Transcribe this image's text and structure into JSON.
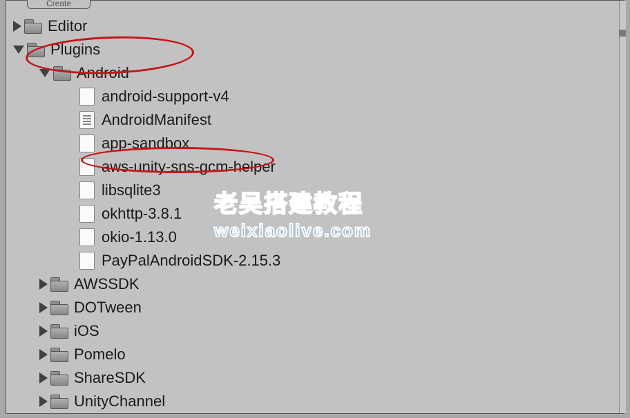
{
  "tab_label": "Create",
  "watermark": {
    "line1": "老吴搭建教程",
    "line2": "weixiaolive.com"
  },
  "tree": {
    "editor": {
      "label": "Editor",
      "type": "folder",
      "expanded": false,
      "depth": 0
    },
    "plugins": {
      "label": "Plugins",
      "type": "folder",
      "expanded": true,
      "depth": 0,
      "circled": true
    },
    "android": {
      "label": "Android",
      "type": "folder",
      "expanded": true,
      "depth": 1
    },
    "files": [
      {
        "label": "android-support-v4",
        "icon": "file"
      },
      {
        "label": "AndroidManifest",
        "icon": "manifest"
      },
      {
        "label": "app-sandbox",
        "icon": "file",
        "circled": true
      },
      {
        "label": "aws-unity-sns-gcm-helper",
        "icon": "file"
      },
      {
        "label": "libsqlite3",
        "icon": "file"
      },
      {
        "label": "okhttp-3.8.1",
        "icon": "file"
      },
      {
        "label": "okio-1.13.0",
        "icon": "file"
      },
      {
        "label": "PayPalAndroidSDK-2.15.3",
        "icon": "file"
      }
    ],
    "subfolders": [
      {
        "label": "AWSSDK"
      },
      {
        "label": "DOTween"
      },
      {
        "label": "iOS"
      },
      {
        "label": "Pomelo"
      },
      {
        "label": "ShareSDK"
      },
      {
        "label": "UnityChannel"
      }
    ]
  }
}
